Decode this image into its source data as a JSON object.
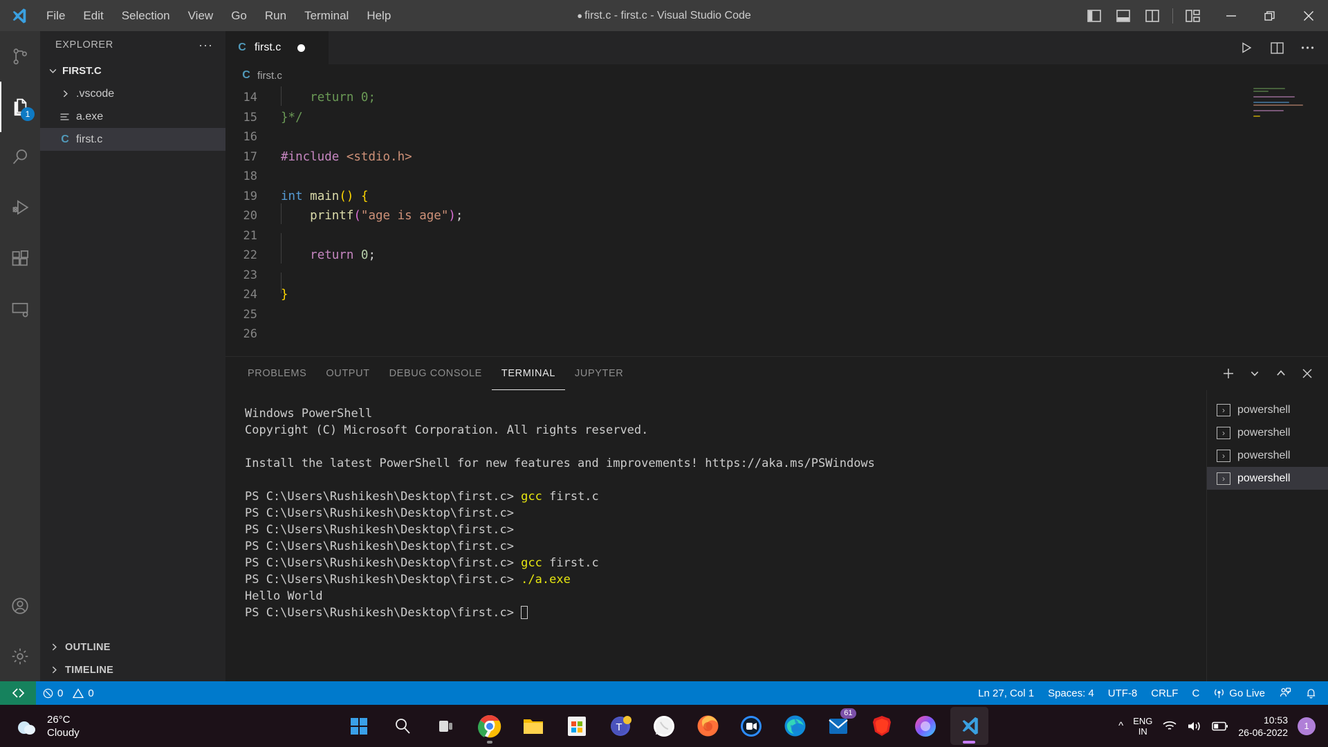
{
  "window": {
    "title": "first.c - first.c - Visual Studio Code",
    "unsaved_dot": "●"
  },
  "menu": {
    "items": [
      {
        "label": "File"
      },
      {
        "label": "Edit"
      },
      {
        "label": "Selection"
      },
      {
        "label": "View"
      },
      {
        "label": "Go"
      },
      {
        "label": "Run"
      },
      {
        "label": "Terminal"
      },
      {
        "label": "Help"
      }
    ]
  },
  "titlebar_controls": {
    "toggle_primary_sidebar": "toggle-primary-sidebar-icon",
    "toggle_panel": "toggle-panel-icon",
    "toggle_secondary_sidebar": "toggle-secondary-sidebar-icon",
    "customize_layout": "customize-layout-icon",
    "minimize": "minimize-icon",
    "maximize": "maximize-restore-icon",
    "close": "close-icon"
  },
  "activitybar": {
    "items": [
      {
        "name": "source-control",
        "icon": "source-control-icon",
        "active": false,
        "badge": ""
      },
      {
        "name": "explorer",
        "icon": "files-icon",
        "active": true,
        "badge": "1"
      },
      {
        "name": "search",
        "icon": "search-icon",
        "active": false,
        "badge": ""
      },
      {
        "name": "run-and-debug",
        "icon": "run-debug-icon",
        "active": false,
        "badge": ""
      },
      {
        "name": "extensions",
        "icon": "extensions-icon",
        "active": false,
        "badge": ""
      },
      {
        "name": "remote-explorer",
        "icon": "remote-icon",
        "active": false,
        "badge": ""
      }
    ],
    "bottom": [
      {
        "name": "accounts",
        "icon": "account-icon"
      },
      {
        "name": "manage",
        "icon": "gear-icon"
      }
    ]
  },
  "sidebar": {
    "title": "EXPLORER",
    "more_actions": "···",
    "root": {
      "label": "FIRST.C",
      "expanded": true
    },
    "files": [
      {
        "label": ".vscode",
        "type": "folder",
        "expanded": false,
        "selected": false
      },
      {
        "label": "a.exe",
        "type": "binary",
        "expanded": false,
        "selected": false
      },
      {
        "label": "first.c",
        "type": "c",
        "expanded": false,
        "selected": true
      }
    ],
    "sections": [
      {
        "label": "OUTLINE"
      },
      {
        "label": "TIMELINE"
      }
    ]
  },
  "editor": {
    "tabs": [
      {
        "label": "first.c",
        "icon": "c-file-icon",
        "dirty": true,
        "active": true
      }
    ],
    "actions": [
      {
        "name": "run-code-button",
        "icon": "play-icon"
      },
      {
        "name": "split-editor-button",
        "icon": "split-editor-icon"
      },
      {
        "name": "more-actions-button",
        "icon": "ellipsis-icon"
      }
    ],
    "breadcrumb": [
      {
        "label": "first.c",
        "icon": "c-file-icon"
      }
    ],
    "first_visible_line": 14,
    "lines": [
      {
        "n": 14,
        "indent_guide": true,
        "tokens": [
          {
            "t": "    ",
            "c": "plain"
          },
          {
            "t": "return 0;",
            "c": "comment"
          }
        ]
      },
      {
        "n": 15,
        "indent_guide": false,
        "tokens": [
          {
            "t": "}*/",
            "c": "comment"
          }
        ]
      },
      {
        "n": 16,
        "indent_guide": false,
        "tokens": []
      },
      {
        "n": 17,
        "indent_guide": false,
        "tokens": [
          {
            "t": "#include",
            "c": "pre"
          },
          {
            "t": " ",
            "c": "plain"
          },
          {
            "t": "<stdio.h>",
            "c": "inc"
          }
        ]
      },
      {
        "n": 18,
        "indent_guide": false,
        "tokens": []
      },
      {
        "n": 19,
        "indent_guide": false,
        "tokens": [
          {
            "t": "int",
            "c": "kw"
          },
          {
            "t": " ",
            "c": "plain"
          },
          {
            "t": "main",
            "c": "fn"
          },
          {
            "t": "()",
            "c": "paren"
          },
          {
            "t": " ",
            "c": "plain"
          },
          {
            "t": "{",
            "c": "paren"
          }
        ]
      },
      {
        "n": 20,
        "indent_guide": true,
        "tokens": [
          {
            "t": "    ",
            "c": "plain"
          },
          {
            "t": "printf",
            "c": "fn"
          },
          {
            "t": "(",
            "c": "paren2"
          },
          {
            "t": "\"age is age\"",
            "c": "str"
          },
          {
            "t": ")",
            "c": "paren2"
          },
          {
            "t": ";",
            "c": "plain"
          }
        ]
      },
      {
        "n": 21,
        "indent_guide": true,
        "tokens": []
      },
      {
        "n": 22,
        "indent_guide": true,
        "tokens": [
          {
            "t": "    ",
            "c": "plain"
          },
          {
            "t": "return",
            "c": "ctl"
          },
          {
            "t": " ",
            "c": "plain"
          },
          {
            "t": "0",
            "c": "num"
          },
          {
            "t": ";",
            "c": "plain"
          }
        ]
      },
      {
        "n": 23,
        "indent_guide": true,
        "tokens": []
      },
      {
        "n": 24,
        "indent_guide": false,
        "tokens": [
          {
            "t": "}",
            "c": "paren"
          }
        ]
      },
      {
        "n": 25,
        "indent_guide": false,
        "tokens": []
      },
      {
        "n": 26,
        "indent_guide": false,
        "tokens": []
      }
    ]
  },
  "panel": {
    "tabs": [
      {
        "label": "PROBLEMS",
        "active": false
      },
      {
        "label": "OUTPUT",
        "active": false
      },
      {
        "label": "DEBUG CONSOLE",
        "active": false
      },
      {
        "label": "TERMINAL",
        "active": true
      },
      {
        "label": "JUPYTER",
        "active": false
      }
    ],
    "actions": [
      {
        "name": "new-terminal-button",
        "icon": "plus-icon"
      },
      {
        "name": "terminal-profile-dropdown",
        "icon": "chevron-down-icon"
      },
      {
        "name": "maximize-panel-button",
        "icon": "chevron-up-icon"
      },
      {
        "name": "close-panel-button",
        "icon": "close-icon"
      }
    ],
    "terminal_list": [
      {
        "label": "powershell",
        "icon": "terminal-icon",
        "active": false
      },
      {
        "label": "powershell",
        "icon": "terminal-icon",
        "active": false
      },
      {
        "label": "powershell",
        "icon": "terminal-icon",
        "active": false
      },
      {
        "label": "powershell",
        "icon": "terminal-icon",
        "active": true
      }
    ],
    "terminal_lines": [
      [
        {
          "t": "Windows PowerShell",
          "c": "plain"
        }
      ],
      [
        {
          "t": "Copyright (C) Microsoft Corporation. All rights reserved.",
          "c": "plain"
        }
      ],
      [],
      [
        {
          "t": "Install the latest PowerShell for new features and improvements! https://aka.ms/PSWindows",
          "c": "plain"
        }
      ],
      [],
      [
        {
          "t": "PS C:\\Users\\Rushikesh\\Desktop\\first.c> ",
          "c": "plain"
        },
        {
          "t": "gcc",
          "c": "yellow"
        },
        {
          "t": " first.c",
          "c": "plain"
        }
      ],
      [
        {
          "t": "PS C:\\Users\\Rushikesh\\Desktop\\first.c>",
          "c": "plain"
        }
      ],
      [
        {
          "t": "PS C:\\Users\\Rushikesh\\Desktop\\first.c>",
          "c": "plain"
        }
      ],
      [
        {
          "t": "PS C:\\Users\\Rushikesh\\Desktop\\first.c>",
          "c": "plain"
        }
      ],
      [
        {
          "t": "PS C:\\Users\\Rushikesh\\Desktop\\first.c> ",
          "c": "plain"
        },
        {
          "t": "gcc",
          "c": "yellow"
        },
        {
          "t": " first.c",
          "c": "plain"
        }
      ],
      [
        {
          "t": "PS C:\\Users\\Rushikesh\\Desktop\\first.c> ",
          "c": "plain"
        },
        {
          "t": "./a.exe",
          "c": "yellow"
        }
      ],
      [
        {
          "t": "Hello World",
          "c": "plain"
        }
      ],
      [
        {
          "t": "PS C:\\Users\\Rushikesh\\Desktop\\first.c> ",
          "c": "plain"
        },
        {
          "t": "",
          "c": "cursor"
        }
      ]
    ]
  },
  "statusbar": {
    "remote_icon": "remote-window-icon",
    "errors": "0",
    "warnings": "0",
    "right": [
      {
        "name": "editor-position",
        "label": "Ln 27, Col 1"
      },
      {
        "name": "editor-indentation",
        "label": "Spaces: 4"
      },
      {
        "name": "editor-encoding",
        "label": "UTF-8"
      },
      {
        "name": "editor-eol",
        "label": "CRLF"
      },
      {
        "name": "editor-language",
        "label": "C"
      },
      {
        "name": "go-live",
        "label": "Go Live",
        "icon": "broadcast-icon"
      },
      {
        "name": "feedback",
        "label": "",
        "icon": "feedback-icon"
      },
      {
        "name": "notifications",
        "label": "",
        "icon": "bell-icon"
      }
    ]
  },
  "taskbar": {
    "weather": {
      "temperature": "26°C",
      "condition": "Cloudy",
      "icon": "cloud-icon"
    },
    "apps": [
      {
        "name": "start-button",
        "icon": "windows-logo-icon",
        "badge": "",
        "state": "idle"
      },
      {
        "name": "search-button",
        "icon": "search-icon",
        "badge": "",
        "state": "idle"
      },
      {
        "name": "task-view-button",
        "icon": "task-view-icon",
        "badge": "",
        "state": "idle"
      },
      {
        "name": "google-chrome",
        "icon": "chrome-icon",
        "badge": "",
        "state": "running"
      },
      {
        "name": "file-explorer",
        "icon": "folder-icon",
        "badge": "",
        "state": "idle"
      },
      {
        "name": "microsoft-store",
        "icon": "store-icon",
        "badge": "",
        "state": "idle"
      },
      {
        "name": "microsoft-teams",
        "icon": "teams-icon",
        "badge": "",
        "state": "idle"
      },
      {
        "name": "whatsapp",
        "icon": "whatsapp-icon",
        "badge": "",
        "state": "idle"
      },
      {
        "name": "firefox",
        "icon": "firefox-icon",
        "badge": "",
        "state": "idle"
      },
      {
        "name": "zoom",
        "icon": "zoom-icon",
        "badge": "",
        "state": "idle"
      },
      {
        "name": "microsoft-edge",
        "icon": "edge-icon",
        "badge": "",
        "state": "idle"
      },
      {
        "name": "mail",
        "icon": "mail-icon",
        "badge": "61",
        "state": "idle"
      },
      {
        "name": "brave",
        "icon": "brave-icon",
        "badge": "",
        "state": "idle"
      },
      {
        "name": "photos",
        "icon": "photos-icon",
        "badge": "",
        "state": "idle"
      },
      {
        "name": "visual-studio-code",
        "icon": "vscode-icon",
        "badge": "",
        "state": "focused"
      }
    ],
    "tray": {
      "overflow": "^",
      "language_top": "ENG",
      "language_bottom": "IN",
      "wifi_icon": "wifi-icon",
      "volume_icon": "volume-icon",
      "battery_icon": "battery-icon",
      "time": "10:53",
      "date": "26-06-2022",
      "notification_count": "1"
    }
  },
  "colors": {
    "accent": "#007acc",
    "titlebar_bg": "#3c3c3c",
    "activitybar_bg": "#333333",
    "sidebar_bg": "#252526",
    "editor_bg": "#1e1e1e",
    "badge_blue": "#0e7ac4",
    "remote_green": "#16825d",
    "terminal_yellow": "#e5e510"
  }
}
